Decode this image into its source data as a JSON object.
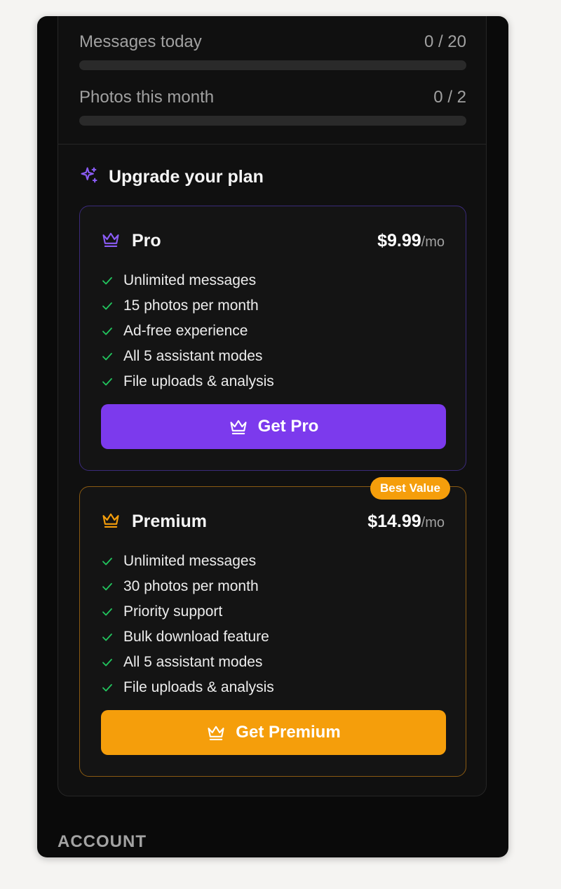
{
  "usage": [
    {
      "label": "Messages today",
      "value": "0 / 20",
      "progress": 0
    },
    {
      "label": "Photos this month",
      "value": "0 / 2",
      "progress": 0
    }
  ],
  "upgrade": {
    "title": "Upgrade your plan",
    "icon": "sparkles-icon"
  },
  "plans": {
    "pro": {
      "name": "Pro",
      "price": "$9.99",
      "period": "/mo",
      "accent": "#7c3aed",
      "icon": "crown-icon",
      "features": [
        "Unlimited messages",
        "15 photos per month",
        "Ad-free experience",
        "All 5 assistant modes",
        "File uploads & analysis"
      ],
      "button_label": "Get Pro"
    },
    "premium": {
      "name": "Premium",
      "price": "$14.99",
      "period": "/mo",
      "badge": "Best Value",
      "accent": "#f59e0b",
      "icon": "crown-icon",
      "features": [
        "Unlimited messages",
        "30 photos per month",
        "Priority support",
        "Bulk download feature",
        "All 5 assistant modes",
        "File uploads & analysis"
      ],
      "button_label": "Get Premium"
    }
  },
  "colors": {
    "check": "#22c55e"
  },
  "account_section_label": "ACCOUNT"
}
